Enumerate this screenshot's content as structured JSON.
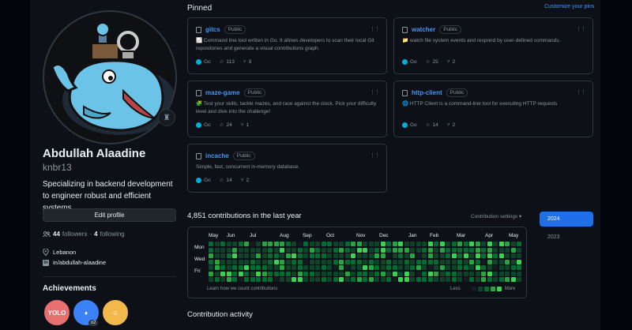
{
  "profile": {
    "name": "Abdullah Alaadine",
    "login": "knbr13",
    "bio": "Specializing in backend development to engineer robust and efficient systems.",
    "edit_label": "Edit profile",
    "followers_count": "44",
    "followers_label": "followers",
    "following_count": "4",
    "following_label": "following",
    "location": "Lebanon",
    "linkedin": "in/abdullah-alaadine",
    "achievements_title": "Achievements",
    "badge_multiplier": "x2",
    "badges": [
      {
        "name": "yolo-badge",
        "glyph": "YOLO",
        "bg": "#e76f6f"
      },
      {
        "name": "shark-badge",
        "glyph": "♦",
        "bg": "#3b82f6"
      },
      {
        "name": "starstruck-badge",
        "glyph": "☺",
        "bg": "#f2b84b"
      }
    ]
  },
  "pinned": {
    "title": "Pinned",
    "customize_label": "Customize your pins",
    "visibility_label": "Public",
    "repos": [
      {
        "name": "gitcs",
        "desc": "📈 Command line tool written in Go. It allows developers to scan their local Git repositories and generate a visual contributions graph.",
        "language": "Go",
        "stars": "113",
        "forks": "9"
      },
      {
        "name": "watcher",
        "desc": "📁 watch file system events and respond by user-defined commands.",
        "language": "Go",
        "stars": "25",
        "forks": "2"
      },
      {
        "name": "maze-game",
        "desc": "🧩 Test your skills, tackle mazes, and race against the clock. Pick your difficulty level and dive into the challenge!",
        "language": "Go",
        "stars": "24",
        "forks": "1"
      },
      {
        "name": "http-client",
        "desc": "🌐 HTTP Client is a command-line tool for executing HTTP requests",
        "language": "Go",
        "stars": "14",
        "forks": "2"
      },
      {
        "name": "incache",
        "desc": "Simple, fast, concurrent in-memory database.",
        "language": "Go",
        "stars": "14",
        "forks": "2"
      }
    ]
  },
  "contributions": {
    "title": "4,851 contributions in the last year",
    "settings_label": "Contribution settings ▾",
    "months": [
      "May",
      "Jun",
      "Jul",
      "Aug",
      "Sep",
      "Oct",
      "Nov",
      "Dec",
      "Jan",
      "Feb",
      "Mar",
      "Apr",
      "May"
    ],
    "days": [
      "Mon",
      "Wed",
      "Fri"
    ],
    "learn_label": "Learn how we count contributions",
    "less_label": "Less",
    "more_label": "More",
    "colors": [
      "#161b22",
      "#0e4429",
      "#006d32",
      "#26a641",
      "#39d353"
    ],
    "years": [
      "2024",
      "2023"
    ],
    "selected_year": "2024"
  },
  "activity": {
    "title": "Contribution activity"
  }
}
